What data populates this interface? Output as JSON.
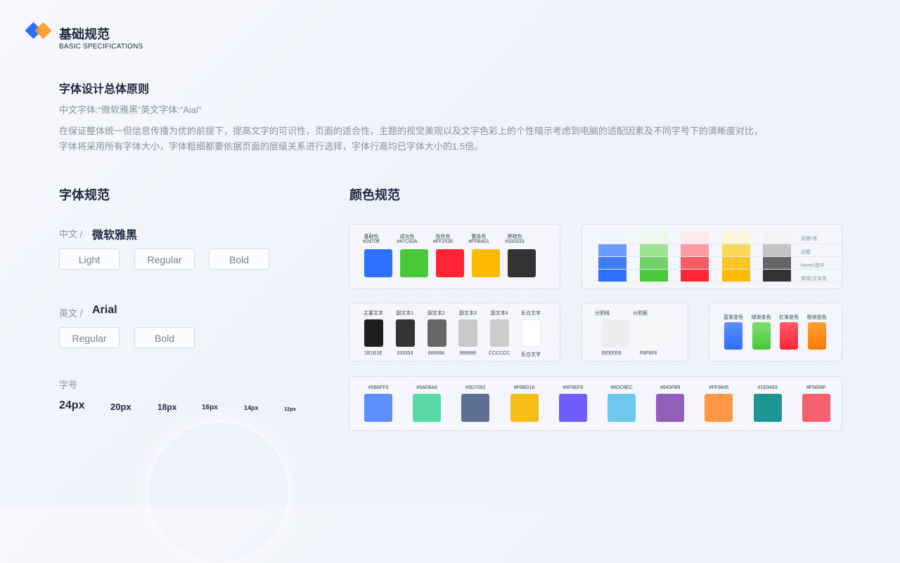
{
  "header": {
    "title": "基础规范",
    "subtitle": "BASIC SPECIFICATIONS"
  },
  "intro": {
    "heading": "字体设计总体原则",
    "fonts_line": "中文字体:“微软雅黑”英文字体:“Aial”",
    "para_line1": "在保证整体统一但信息传播为优的前提下，提高文字的可识性，页面的适合性，主题的视觉美观以及文字色彩上的个性暗示考虑到电脑的适配因素及不同字号下的清晰度对比，",
    "para_line2": "字体将采用所有字体大小，字体粗细都要依据页面的层级关系进行选择，字体行高均已字体大小的1.5倍。"
  },
  "font_spec": {
    "heading": "字体规范",
    "cn_label": "中文 /",
    "cn_font": "微软雅黑",
    "cn_weights": [
      "Light",
      "Regular",
      "Bold"
    ],
    "en_label": "英文 /",
    "en_font": "Arial",
    "en_weights": [
      "Regular",
      "Bold"
    ],
    "size_label": "字号",
    "sizes": [
      "24px",
      "20px",
      "18px",
      "16px",
      "14px",
      "12px"
    ]
  },
  "color_spec": {
    "heading": "颜色规范",
    "base": [
      {
        "name": "基础色",
        "hex": "#2d70ff",
        "color": "#2d70ff"
      },
      {
        "name": "成功色",
        "hex": "#47C93A",
        "color": "#47c93a"
      },
      {
        "name": "危险色",
        "hex": "#FF2536",
        "color": "#ff2536"
      },
      {
        "name": "警告色",
        "hex": "#FFBA01",
        "color": "#ffba01"
      },
      {
        "name": "黑暗色",
        "hex": "#333333",
        "color": "#333333"
      }
    ],
    "scale_labels": [
      "背景/浅",
      "边框",
      "hover/选中",
      "常规/文本色"
    ],
    "scale_columns": [
      [
        "#f0f4fd",
        "#6d9bfa",
        "#3e7bf6",
        "#2d70ff"
      ],
      [
        "#ecf9eb",
        "#9de394",
        "#6ed364",
        "#47c93a"
      ],
      [
        "#fde9ea",
        "#fa9ca2",
        "#f55c66",
        "#ff2536"
      ],
      [
        "#fdf6dc",
        "#fcd75a",
        "#fbc623",
        "#ffba01"
      ],
      [
        "#f3f3f5",
        "#c4c4c4",
        "#666666",
        "#333333"
      ]
    ],
    "text_colors": [
      {
        "name": "主要文本",
        "hex": "1E1E1E",
        "color": "#1e1e1e"
      },
      {
        "name": "副文本1",
        "hex": "333333",
        "color": "#333333"
      },
      {
        "name": "副文本2",
        "hex": "666666",
        "color": "#666666"
      },
      {
        "name": "副文本3",
        "hex": "999999",
        "color": "#c9c9c9"
      },
      {
        "name": "副文本4",
        "hex": "CCCCCC",
        "color": "#cccccc"
      },
      {
        "name": "反白文字",
        "hex": "反白文字",
        "color": "#ffffff"
      }
    ],
    "dividers": [
      {
        "name": "分割线",
        "hex": "EEEEEE",
        "color": "#eeeeee"
      },
      {
        "name": "分割面",
        "hex": "F6F6F6",
        "color": "#f6f6f6"
      }
    ],
    "gradients": [
      {
        "name": "蓝渐变色",
        "from": "#5b8ff9",
        "to": "#2d70ff"
      },
      {
        "name": "绿渐变色",
        "from": "#7ee06f",
        "to": "#47c93a"
      },
      {
        "name": "红渐变色",
        "from": "#ff5a6a",
        "to": "#ff2536"
      },
      {
        "name": "橙渐变色",
        "from": "#ffa030",
        "to": "#ff7a00"
      }
    ],
    "palette": [
      {
        "hex": "#5B8FF9",
        "color": "#5b8ff9"
      },
      {
        "hex": "#5AD8A6",
        "color": "#5ad8a6"
      },
      {
        "hex": "#5D7092",
        "color": "#5d7092"
      },
      {
        "hex": "#F6BD16",
        "color": "#f6bd16"
      },
      {
        "hex": "#6F5EF9",
        "color": "#6f5ef9"
      },
      {
        "hex": "#6DC8EC",
        "color": "#6dc8ec"
      },
      {
        "hex": "#945FB9",
        "color": "#945fb9"
      },
      {
        "hex": "#FF9845",
        "color": "#ff9845"
      },
      {
        "hex": "#1E9493",
        "color": "#1e9493"
      },
      {
        "hex": "#F5606F",
        "color": "#f5606f"
      }
    ]
  }
}
